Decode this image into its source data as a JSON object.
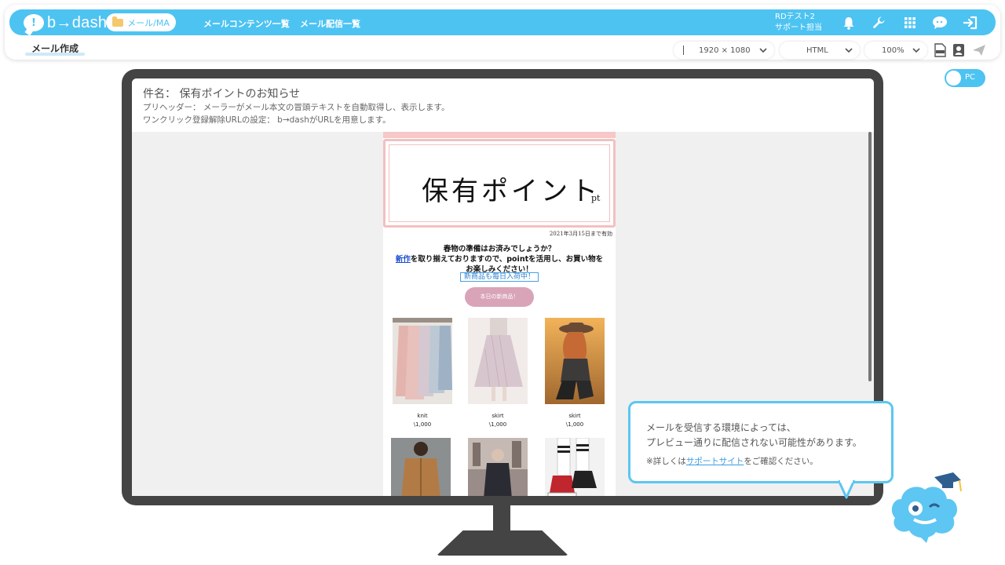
{
  "app": {
    "logo_text": "b→dash",
    "logo_mark": "!"
  },
  "nav": {
    "active_label": "メール/MA",
    "links": [
      "メールコンテンツ一覧",
      "メール配信一覧"
    ]
  },
  "user": {
    "line1": "RDテスト2",
    "line2": "サポート担当"
  },
  "icons": [
    "bell-icon",
    "wrench-icon",
    "grid-icon",
    "chat-icon",
    "logout-icon",
    "html-file-icon",
    "contact-card-icon",
    "send-icon"
  ],
  "colors": {
    "brand": "#4dc3f2",
    "pink": "#f3c0c0",
    "button_pink": "#d9a4b8",
    "monitor": "#444444"
  },
  "subtab": {
    "label": "メール作成"
  },
  "toolbar": {
    "resolution": "1920 × 1080",
    "format": "HTML",
    "zoom": "100%"
  },
  "device_toggle": {
    "label": "PC"
  },
  "mail": {
    "subject": "件名： 保有ポイントのお知らせ",
    "preheader": "プリヘッダー： メーラーがメール本文の冒頭テキストを自動取得し、表示します。",
    "unsubscribe": "ワンクリック登録解除URLの設定： b→dashがURLを用意します。"
  },
  "email": {
    "point_title": "保有ポイント",
    "point_unit": "pt",
    "expiry": "2021年3月15日まで有効",
    "line1": "春物の準備はお済みでしょうか？",
    "line2_link": "新作",
    "line2_rest": "を取り揃えておりますので、pointを活用し、お買い物を",
    "line3": "お楽しみください！",
    "tag": "新商品も毎日入荷中！",
    "button": "本日の新商品！",
    "products": [
      {
        "name": "knit",
        "price": "\\1,000"
      },
      {
        "name": "skirt",
        "price": "\\1,000"
      },
      {
        "name": "skirt",
        "price": "\\1,000"
      }
    ]
  },
  "notice": {
    "line1": "メールを受信する環境によっては、",
    "line2": "プレビュー通りに配信されない可能性があります。",
    "line3_pre": "※詳しくは",
    "line3_link": "サポートサイト",
    "line3_post": "をご確認ください。"
  }
}
